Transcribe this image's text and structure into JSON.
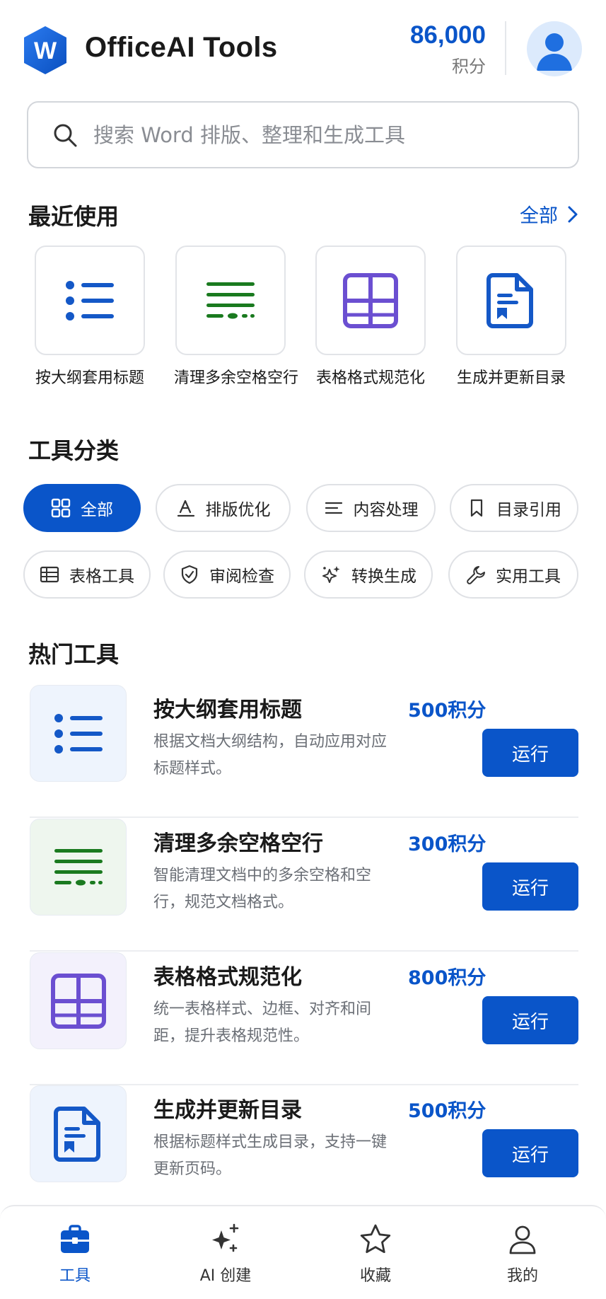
{
  "header": {
    "logo_letter": "W",
    "app_title": "OfficeAI Tools",
    "points_value": "86,000",
    "points_unit": "积分"
  },
  "search": {
    "placeholder": "搜索 Word 排版、整理和生成工具"
  },
  "recent": {
    "title": "最近使用",
    "see_all": "全部",
    "items": [
      {
        "label": "按大纲套用标题",
        "icon": "list-icon"
      },
      {
        "label": "清理多余空格空行",
        "icon": "text-cleanup-icon"
      },
      {
        "label": "表格格式规范化",
        "icon": "table-grid-icon"
      },
      {
        "label": "生成并更新目录",
        "icon": "document-bookmark-icon"
      }
    ]
  },
  "categories": {
    "title": "工具分类",
    "items": [
      {
        "label": "全部",
        "icon": "grid-icon",
        "active": true
      },
      {
        "label": "排版优化",
        "icon": "text-format-icon"
      },
      {
        "label": "内容处理",
        "icon": "align-left-icon"
      },
      {
        "label": "目录引用",
        "icon": "bookmark-icon"
      },
      {
        "label": "表格工具",
        "icon": "table-icon"
      },
      {
        "label": "审阅检查",
        "icon": "shield-check-icon"
      },
      {
        "label": "转换生成",
        "icon": "sparkles-icon"
      },
      {
        "label": "实用工具",
        "icon": "wrench-icon"
      }
    ]
  },
  "hot_tools": {
    "title": "热门工具",
    "items": [
      {
        "name": "按大纲套用标题",
        "cost": "500积分",
        "desc": "根据文档大纲结构，自动应用对应标题样式。",
        "run_label": "运行",
        "icon": "list-icon"
      },
      {
        "name": "清理多余空格空行",
        "cost": "300积分",
        "desc": "智能清理文档中的多余空格和空行，规范文档格式。",
        "run_label": "运行",
        "icon": "text-cleanup-icon"
      },
      {
        "name": "表格格式规范化",
        "cost": "800积分",
        "desc": "统一表格样式、边框、对齐和间距，提升表格规范性。",
        "run_label": "运行",
        "icon": "table-grid-icon"
      },
      {
        "name": "生成并更新目录",
        "cost": "500积分",
        "desc": "根据标题样式生成目录，支持一键更新页码。",
        "run_label": "运行",
        "icon": "document-bookmark-icon"
      }
    ]
  },
  "bottom_nav": {
    "items": [
      {
        "label": "工具",
        "icon": "briefcase-icon",
        "active": true
      },
      {
        "label": "AI 创建",
        "icon": "ai-sparkle-icon"
      },
      {
        "label": "收藏",
        "icon": "star-icon"
      },
      {
        "label": "我的",
        "icon": "user-icon"
      }
    ]
  },
  "colors": {
    "primary": "#0a55c9",
    "green": "#1a7a1f",
    "purple": "#6b4fd1",
    "muted_text": "#6b6f76"
  }
}
